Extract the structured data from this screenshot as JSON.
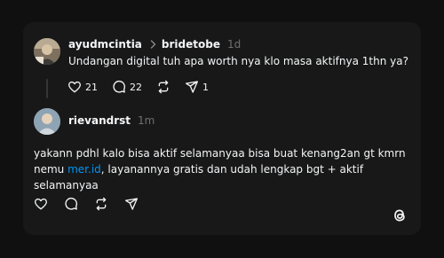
{
  "post": {
    "author": "ayudmcintia",
    "reply_to": "bridetobe",
    "time": "1d",
    "text": "Undangan digital tuh apa worth nya klo masa aktifnya 1thn ya?",
    "likes": "21",
    "comments": "22",
    "shares": "1"
  },
  "reply": {
    "author": "rievandrst",
    "time": "1m",
    "text_part1": "yakann pdhl kalo bisa aktif selamanyaa bisa buat kenang2an gt kmrn nemu ",
    "link": "mer.id",
    "text_part2": ", layanannya gratis dan udah lengkap bgt + aktif selamanyaa"
  },
  "colors": {
    "background": "#101010",
    "card": "#181818",
    "text": "#f3f5f7",
    "secondary_text": "#6f6f6f",
    "link": "#0095f6"
  },
  "icons": [
    "heart-icon",
    "comment-icon",
    "repost-icon",
    "share-icon",
    "chevron-right-icon",
    "threads-logo-icon"
  ]
}
